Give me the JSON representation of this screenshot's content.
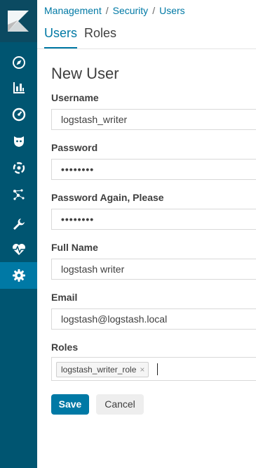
{
  "breadcrumb": [
    "Management",
    "Security",
    "Users"
  ],
  "tabs": [
    {
      "label": "Users",
      "active": true
    },
    {
      "label": "Roles",
      "active": false
    }
  ],
  "sidebar": {
    "items": [
      {
        "icon": "compass-icon",
        "label": "Discover"
      },
      {
        "icon": "bar-chart-icon",
        "label": "Visualize"
      },
      {
        "icon": "dashboard-icon",
        "label": "Dashboard"
      },
      {
        "icon": "timelion-icon",
        "label": "Timelion"
      },
      {
        "icon": "machine-learning-icon",
        "label": "Machine Learning"
      },
      {
        "icon": "graph-icon",
        "label": "Graph"
      },
      {
        "icon": "wrench-icon",
        "label": "Dev Tools"
      },
      {
        "icon": "heartbeat-icon",
        "label": "Monitoring"
      },
      {
        "icon": "gear-icon",
        "label": "Management",
        "active": true
      }
    ]
  },
  "form": {
    "title": "New User",
    "username": {
      "label": "Username",
      "value": "logstash_writer"
    },
    "password": {
      "label": "Password",
      "value": "••••••••"
    },
    "password_again": {
      "label": "Password Again, Please",
      "value": "••••••••"
    },
    "full_name": {
      "label": "Full Name",
      "value": "logstash writer"
    },
    "email": {
      "label": "Email",
      "value": "logstash@logstash.local"
    },
    "roles": {
      "label": "Roles",
      "chips": [
        "logstash_writer_role"
      ],
      "remove_glyph": "×"
    }
  },
  "buttons": {
    "save": "Save",
    "cancel": "Cancel"
  },
  "colors": {
    "sidebar": "#005571",
    "accent": "#0079a5",
    "active_nav": "#0079a5"
  }
}
